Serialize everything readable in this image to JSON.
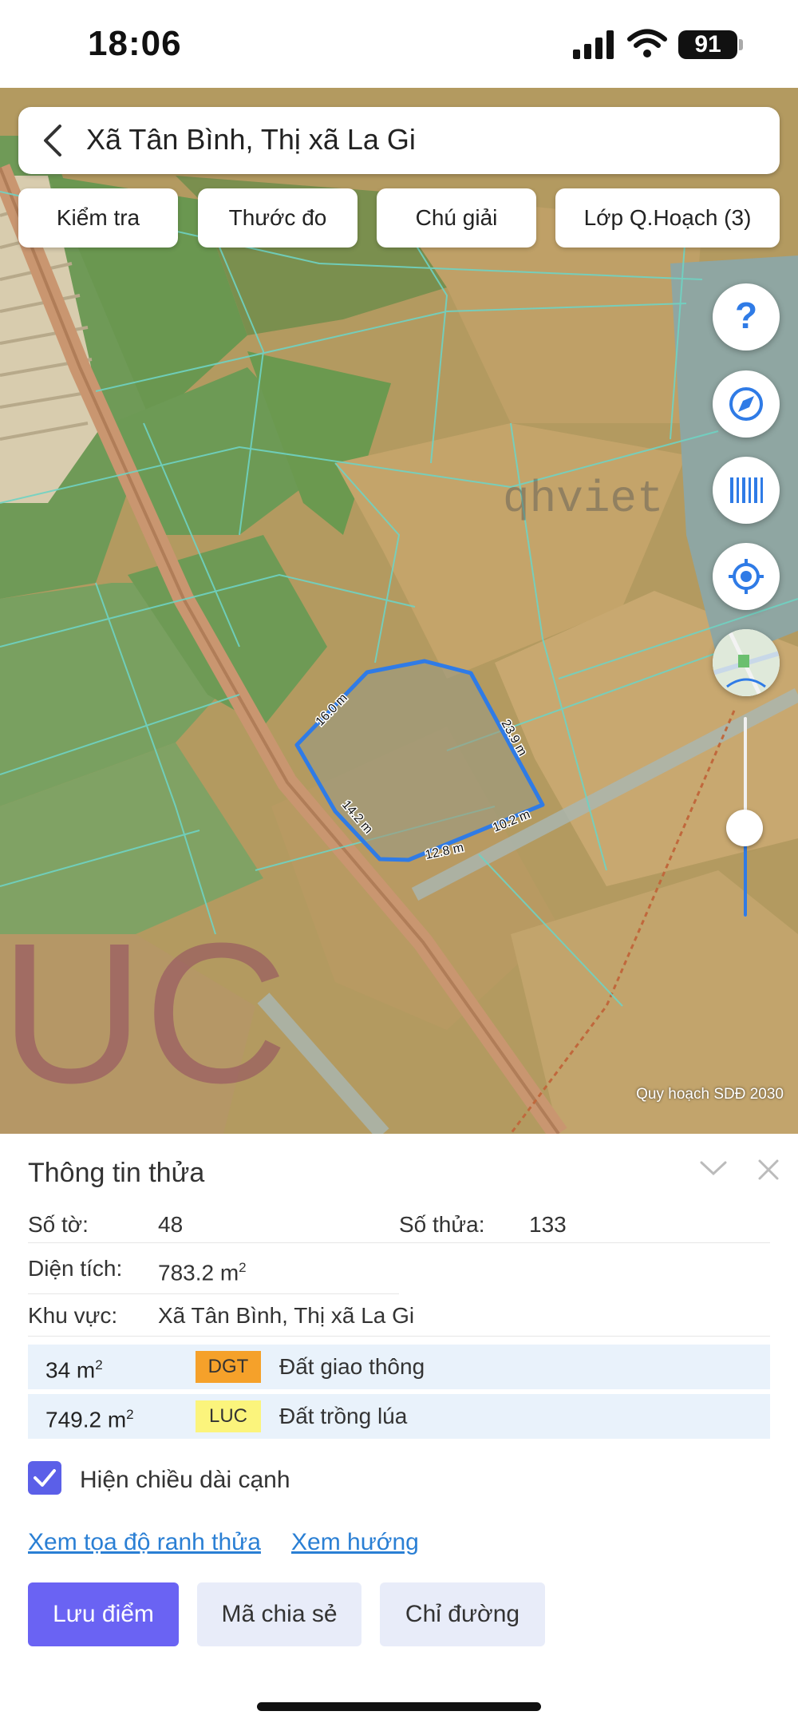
{
  "status_bar": {
    "time": "18:06",
    "battery": "91"
  },
  "search": {
    "location": "Xã Tân Bình, Thị xã La Gi"
  },
  "toolbar": {
    "check": "Kiểm tra",
    "ruler": "Thước đo",
    "legend": "Chú giải",
    "layers": "Lớp Q.Hoạch (3)"
  },
  "map": {
    "watermark_letters": "UC",
    "watermark_text": "qhviet",
    "edge_labels": [
      "16.0 m",
      "23.9 m",
      "10.2 m",
      "12.8 m",
      "14.2 m"
    ],
    "caption": "Quy hoạch SDĐ 2030",
    "zoom_level": 0.35,
    "accent": "#2f7be6"
  },
  "panel": {
    "title": "Thông tin thửa",
    "sheet_label": "Số tờ:",
    "sheet_value": "48",
    "plot_label": "Số thửa:",
    "plot_value": "133",
    "area_label": "Diện tích:",
    "area_value": "783.2 m",
    "area_unit_sup": "2",
    "region_label": "Khu vực:",
    "region_value": "Xã Tân Bình, Thị xã La Gi",
    "land_uses": [
      {
        "area": "34 m",
        "sup": "2",
        "code": "DGT",
        "name": "Đất giao thông",
        "color": "#f5a12a"
      },
      {
        "area": "749.2 m",
        "sup": "2",
        "code": "LUC",
        "name": "Đất trồng lúa",
        "color": "#fbf47c"
      }
    ],
    "show_edge_lengths": "Hiện chiều dài cạnh",
    "show_edge_lengths_checked": true,
    "link_coords": "Xem tọa độ ranh thửa",
    "link_direction": "Xem hướng",
    "btn_save": "Lưu điểm",
    "btn_share": "Mã chia sẻ",
    "btn_directions": "Chỉ đường",
    "primary_color": "#6a63f3"
  },
  "icons": [
    "back-arrow-icon",
    "help-icon",
    "compass-icon",
    "barcode-icon",
    "locate-icon",
    "map-thumbnail-icon",
    "chevron-down-icon",
    "close-icon",
    "checkmark-icon"
  ]
}
